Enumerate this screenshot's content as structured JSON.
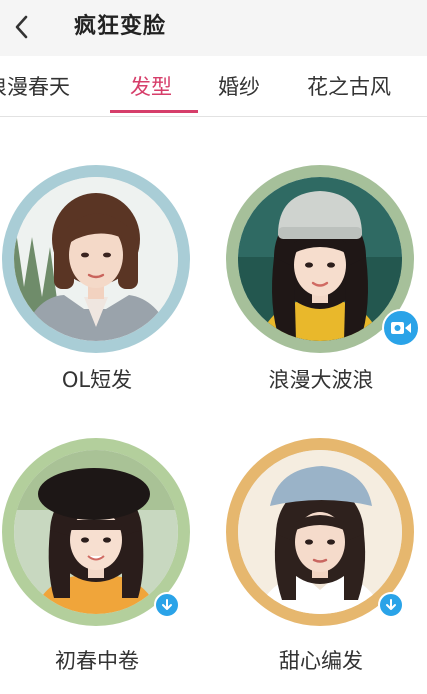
{
  "header": {
    "title": "疯狂变脸"
  },
  "tabs": [
    {
      "label": "浪漫春天",
      "active": false
    },
    {
      "label": "发型",
      "active": true
    },
    {
      "label": "婚纱",
      "active": false
    },
    {
      "label": "花之古风",
      "active": false
    }
  ],
  "styles": [
    {
      "label": "OL短发",
      "ring_color": "#a9cdd6",
      "badge": "none"
    },
    {
      "label": "浪漫大波浪",
      "ring_color": "#a6c09a",
      "badge": "video-icon"
    },
    {
      "label": "初春中卷",
      "ring_color": "#b3cf9c",
      "badge": "download-icon"
    },
    {
      "label": "甜心编发",
      "ring_color": "#e6b76e",
      "badge": "download-icon"
    }
  ],
  "colors": {
    "accent": "#d63e6a",
    "badge_blue": "#2aa3e8"
  }
}
